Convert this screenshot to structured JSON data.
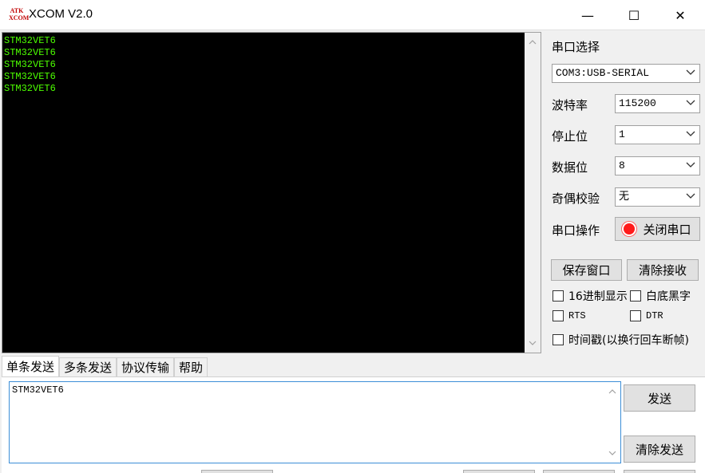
{
  "window": {
    "logo_text": "ATK XCOM",
    "title": "XCOM V2.0",
    "minimize": "—",
    "maximize": "☐",
    "close": "✕"
  },
  "console": {
    "text_color": "#4cff00",
    "background": "#000000",
    "lines": [
      "STM32VET6",
      "STM32VET6",
      "STM32VET6",
      "STM32VET6",
      "STM32VET6"
    ]
  },
  "serial": {
    "port_label": "串口选择",
    "port_value": "COM3:USB-SERIAL",
    "baud_label": "波特率",
    "baud_value": "115200",
    "stop_label": "停止位",
    "stop_value": "1",
    "data_label": "数据位",
    "data_value": "8",
    "parity_label": "奇偶校验",
    "parity_value": "无",
    "op_label": "串口操作",
    "op_button": "关闭串口",
    "led_color": "#ff1a1a"
  },
  "actions": {
    "save_window": "保存窗口",
    "clear_receive": "清除接收"
  },
  "options": {
    "hex_display": "16进制显示",
    "white_black": "白底黑字",
    "rts": "RTS",
    "dtr": "DTR",
    "timestamp": "时间戳(以换行回车断帧)"
  },
  "tabs": [
    "单条发送",
    "多条发送",
    "协议传输",
    "帮助"
  ],
  "send": {
    "input_value": "STM32VET6",
    "send_button": "发送",
    "clear_send_button": "清除发送"
  },
  "icons": {
    "scroll_up": "▲",
    "scroll_down": "▼",
    "chevron": "﹀"
  }
}
